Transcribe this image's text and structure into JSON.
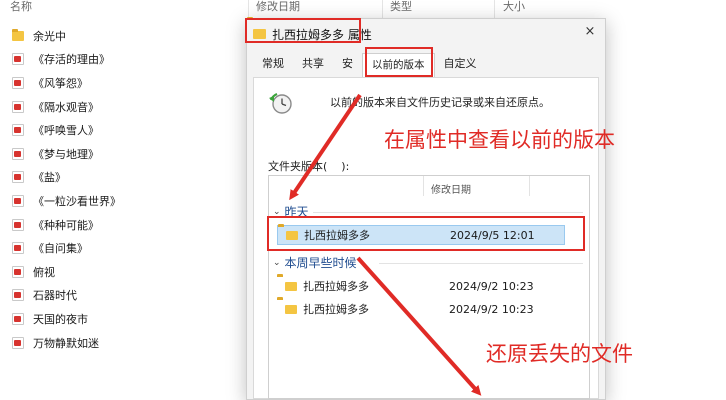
{
  "explorer": {
    "columns": [
      "名称",
      "修改日期",
      "类型",
      "大小"
    ],
    "items": [
      {
        "name": "余光中",
        "icon": "folder-icon"
      },
      {
        "name": "《存活的理由》",
        "icon": "document-icon"
      },
      {
        "name": "《风筝怨》",
        "icon": "document-icon"
      },
      {
        "name": "《隔水观音》",
        "icon": "document-icon"
      },
      {
        "name": "《呼唤雪人》",
        "icon": "document-icon"
      },
      {
        "name": "《梦与地理》",
        "icon": "document-icon"
      },
      {
        "name": "《盐》",
        "icon": "document-icon"
      },
      {
        "name": "《一粒沙看世界》",
        "icon": "document-icon"
      },
      {
        "name": "《种种可能》",
        "icon": "document-icon"
      },
      {
        "name": "《自问集》",
        "icon": "document-icon"
      },
      {
        "name": "俯视",
        "icon": "document-icon"
      },
      {
        "name": "石器时代",
        "icon": "document-icon"
      },
      {
        "name": "天国的夜市",
        "icon": "document-icon"
      },
      {
        "name": "万物静默如迷",
        "icon": "document-icon"
      }
    ]
  },
  "dialog": {
    "title": "扎西拉姆多多 属性",
    "close_glyph": "×",
    "tabs": [
      {
        "label": "常规",
        "active": false
      },
      {
        "label": "共享",
        "active": false
      },
      {
        "label": "安",
        "active": false
      },
      {
        "label": "以前的版本",
        "active": true
      },
      {
        "label": "自定义",
        "active": false
      }
    ],
    "description": "以前的版本来自文件历史记录或来自还原点。",
    "versions_label": "文件夹版本(",
    "versions_label_suffix": "):",
    "list_column_date": "修改日期",
    "groups": [
      {
        "label": "昨天",
        "rows": [
          {
            "name": "扎西拉姆多多",
            "date": "2024/9/5 12:01",
            "selected": true
          }
        ]
      },
      {
        "label": "本周早些时候",
        "rows": [
          {
            "name": "扎西拉姆多多",
            "date": "2024/9/2 10:23",
            "selected": false
          },
          {
            "name": "扎西拉姆多多",
            "date": "2024/9/2 10:23",
            "selected": false
          }
        ]
      }
    ]
  },
  "annotations": {
    "view_previous": "在属性中查看以前的版本",
    "restore_lost": "还原丢失的文件",
    "color": "#e02b26"
  }
}
